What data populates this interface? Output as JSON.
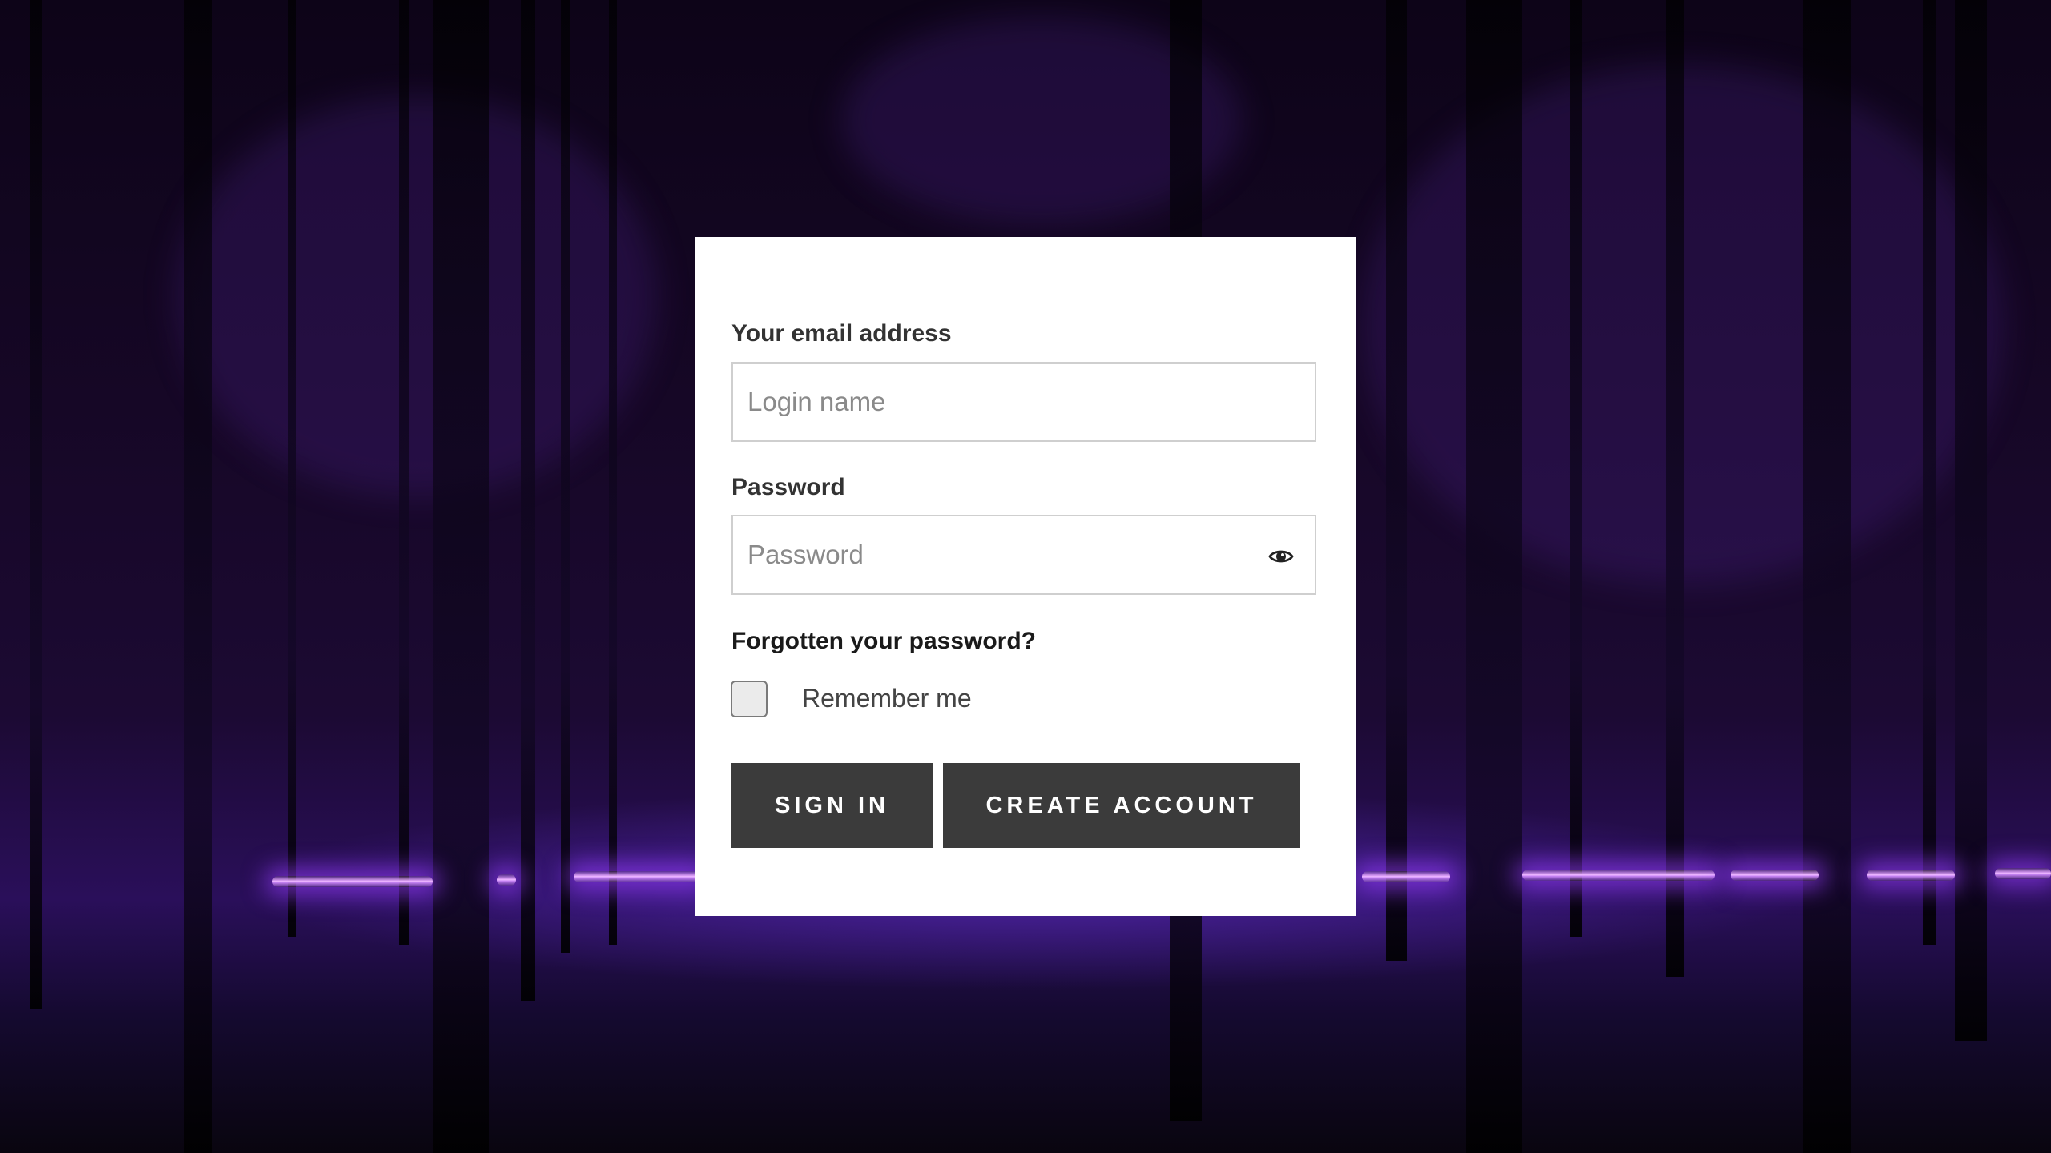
{
  "login_form": {
    "email_label": "Your email address",
    "email_placeholder": "Login name",
    "email_value": "",
    "password_label": "Password",
    "password_placeholder": "Password",
    "password_value": "",
    "show_password_icon": "eye-icon",
    "forgot_password_link": "Forgotten your password?",
    "remember_me_label": "Remember me",
    "remember_me_checked": false,
    "sign_in_button": "SIGN IN",
    "create_account_button": "CREATE ACCOUNT"
  },
  "colors": {
    "button_background": "#3b3b3b",
    "card_background": "#ffffff",
    "accent_glow": "#c77dff"
  }
}
